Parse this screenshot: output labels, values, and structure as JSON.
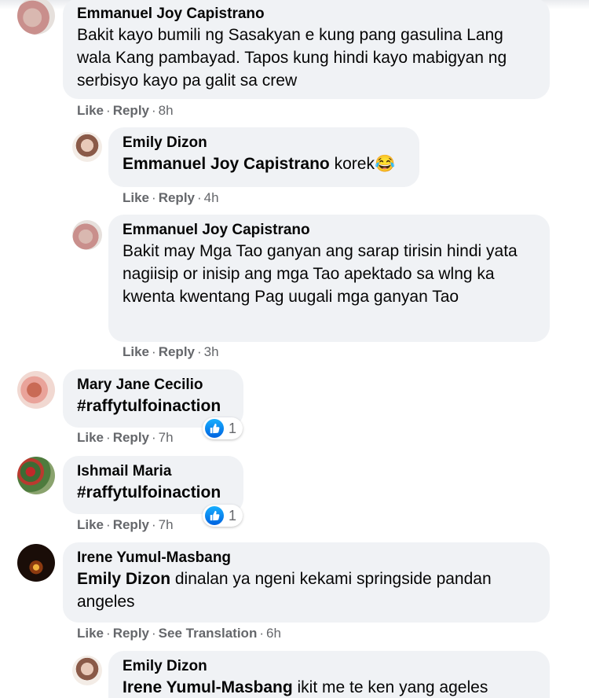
{
  "comments": [
    {
      "author": "Emmanuel Joy Capistrano",
      "text": "Bakit kayo bumili ng Sasakyan e kung pang gasulina Lang wala Kang pambayad. Tapos kung hindi kayo mabigyan ng serbisyo kayo pa galit sa crew",
      "like": "Like",
      "reply": "Reply",
      "time": "8h"
    },
    {
      "author": "Emily Dizon",
      "mention": "Emmanuel Joy Capistrano",
      "text": "korek",
      "emoji": "😂",
      "like": "Like",
      "reply": "Reply",
      "time": "4h"
    },
    {
      "author": "Emmanuel Joy Capistrano",
      "text": "Bakit may Mga Tao ganyan ang sarap tirisin hindi yata nagiisip or inisip ang mga Tao apektado sa wlng ka kwenta kwentang Pag uugali mga ganyan Tao",
      "like": "Like",
      "reply": "Reply",
      "time": "3h"
    },
    {
      "author": "Mary Jane Cecilio",
      "text": "#raffytulfoinaction",
      "like": "Like",
      "reply": "Reply",
      "time": "7h",
      "reaction_count": "1"
    },
    {
      "author": "Ishmail Maria",
      "text": "#raffytulfoinaction",
      "like": "Like",
      "reply": "Reply",
      "time": "7h",
      "reaction_count": "1"
    },
    {
      "author": "Irene Yumul-Masbang",
      "mention": "Emily Dizon",
      "text": "dinalan ya ngeni kekami springside pandan angeles",
      "like": "Like",
      "reply": "Reply",
      "translate": "See Translation",
      "time": "6h"
    },
    {
      "author": "Emily Dizon",
      "mention": "Irene Yumul-Masbang",
      "text": "ikit me te ken yang ageles"
    }
  ],
  "separator": "·",
  "colors": {
    "bubble": "#f0f2f5",
    "meta": "#65676b",
    "like_blue": "#0062df"
  }
}
